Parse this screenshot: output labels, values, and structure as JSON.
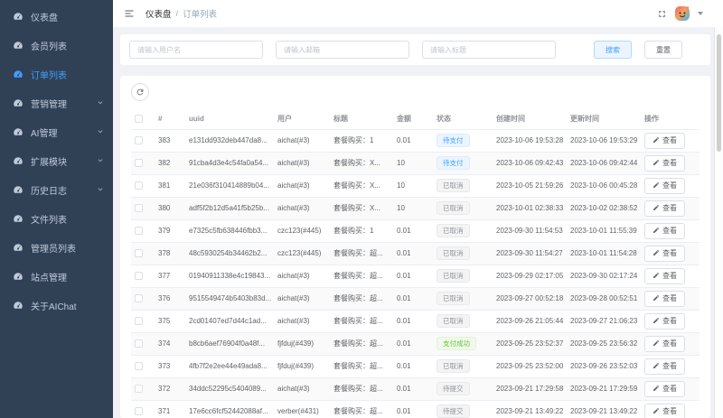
{
  "sidebar": {
    "items": [
      {
        "id": "dashboard",
        "label": "仪表盘",
        "active": false,
        "expandable": false
      },
      {
        "id": "members",
        "label": "会员列表",
        "active": false,
        "expandable": false
      },
      {
        "id": "orders",
        "label": "订单列表",
        "active": true,
        "expandable": false
      },
      {
        "id": "marketing",
        "label": "营销管理",
        "active": false,
        "expandable": true
      },
      {
        "id": "ai",
        "label": "AI管理",
        "active": false,
        "expandable": true
      },
      {
        "id": "modules",
        "label": "扩展模块",
        "active": false,
        "expandable": true
      },
      {
        "id": "logs",
        "label": "历史日志",
        "active": false,
        "expandable": true
      },
      {
        "id": "files",
        "label": "文件列表",
        "active": false,
        "expandable": false
      },
      {
        "id": "admins",
        "label": "管理员列表",
        "active": false,
        "expandable": false
      },
      {
        "id": "site",
        "label": "站点管理",
        "active": false,
        "expandable": false
      },
      {
        "id": "about",
        "label": "关于AIChat",
        "active": false,
        "expandable": false
      }
    ]
  },
  "header": {
    "breadcrumb": {
      "items": [
        "仪表盘",
        "订单列表"
      ],
      "separator": "/"
    },
    "icons": [
      "menu-fold-icon",
      "fullscreen-icon",
      "avatar",
      "caret-down-icon"
    ]
  },
  "filters": {
    "username_placeholder": "请输入用户名",
    "email_placeholder": "请输入邮箱",
    "title_placeholder": "请输入标题",
    "search_label": "搜索",
    "reset_label": "重置"
  },
  "toolbar": {
    "refresh_icon": "refresh-icon"
  },
  "table": {
    "columns": [
      "#",
      "uuid",
      "用户",
      "标题",
      "金额",
      "状态",
      "创建时间",
      "更新时间",
      "操作"
    ],
    "view_label": "查看",
    "rows": [
      {
        "id": "383",
        "uuid": "e131dd932deb447da8...",
        "user": "aichat(#3)",
        "title": "套餐购买：1",
        "amount": "0.01",
        "status": "待支付",
        "status_type": "primary",
        "created": "2023-10-06 19:53:28",
        "updated": "2023-10-06 19:53:29"
      },
      {
        "id": "382",
        "uuid": "91cba4d3e4c54fa0a54...",
        "user": "aichat(#3)",
        "title": "套餐购买：X...",
        "amount": "10",
        "status": "待支付",
        "status_type": "primary",
        "created": "2023-10-06 09:42:43",
        "updated": "2023-10-06 09:42:44"
      },
      {
        "id": "381",
        "uuid": "21e036f310414889b04...",
        "user": "aichat(#3)",
        "title": "套餐购买：X...",
        "amount": "10",
        "status": "已取消",
        "status_type": "info",
        "created": "2023-10-05 21:59:26",
        "updated": "2023-10-06 00:45:28"
      },
      {
        "id": "380",
        "uuid": "adf5f2b12d5a41f5b25b...",
        "user": "aichat(#3)",
        "title": "套餐购买：X...",
        "amount": "10",
        "status": "已取消",
        "status_type": "info",
        "created": "2023-10-01 02:38:33",
        "updated": "2023-10-02 02:38:52"
      },
      {
        "id": "379",
        "uuid": "e7325c5fb638446fbb3...",
        "user": "czc123(#445)",
        "title": "套餐购买：1",
        "amount": "0.01",
        "status": "已取消",
        "status_type": "info",
        "created": "2023-09-30 11:54:53",
        "updated": "2023-10-01 11:55:39"
      },
      {
        "id": "378",
        "uuid": "48c5930254b34462b2...",
        "user": "czc123(#445)",
        "title": "套餐购买：超...",
        "amount": "0.01",
        "status": "已取消",
        "status_type": "info",
        "created": "2023-09-30 11:54:27",
        "updated": "2023-10-01 11:54:28"
      },
      {
        "id": "377",
        "uuid": "01940911338e4c19843...",
        "user": "aichat(#3)",
        "title": "套餐购买：超...",
        "amount": "0.01",
        "status": "已取消",
        "status_type": "info",
        "created": "2023-09-29 02:17:05",
        "updated": "2023-09-30 02:17:24"
      },
      {
        "id": "376",
        "uuid": "9515549474b5403b83d...",
        "user": "aichat(#3)",
        "title": "套餐购买：超...",
        "amount": "0.01",
        "status": "已取消",
        "status_type": "info",
        "created": "2023-09-27 00:52:18",
        "updated": "2023-09-28 00:52:51"
      },
      {
        "id": "375",
        "uuid": "2cd01407ed7d44c1ad...",
        "user": "aichat(#3)",
        "title": "套餐购买：超...",
        "amount": "0.01",
        "status": "已取消",
        "status_type": "info",
        "created": "2023-09-26 21:05:44",
        "updated": "2023-09-27 21:06:23"
      },
      {
        "id": "374",
        "uuid": "b8cb6aef76904f0a48f...",
        "user": "fjfduj(#439)",
        "title": "套餐购买：超...",
        "amount": "0.01",
        "status": "支付成功",
        "status_type": "success",
        "created": "2023-09-25 23:52:37",
        "updated": "2023-09-25 23:56:32"
      },
      {
        "id": "373",
        "uuid": "4fb7f2e2ee44e49ada8...",
        "user": "fjfduj(#439)",
        "title": "套餐购买：超...",
        "amount": "0.01",
        "status": "已取消",
        "status_type": "info",
        "created": "2023-09-25 23:52:00",
        "updated": "2023-09-26 23:52:03"
      },
      {
        "id": "372",
        "uuid": "34ddc52295c5404089...",
        "user": "aichat(#3)",
        "title": "套餐购买：超...",
        "amount": "0.01",
        "status": "待提交",
        "status_type": "info",
        "created": "2023-09-21 17:29:58",
        "updated": "2023-09-21 17:29:59"
      },
      {
        "id": "371",
        "uuid": "17e6cc6fcf52442088af...",
        "user": "verber(#431)",
        "title": "套餐购买：超...",
        "amount": "0.01",
        "status": "待提交",
        "status_type": "info",
        "created": "2023-09-21 13:49:22",
        "updated": "2023-09-21 13:49:22"
      }
    ]
  },
  "colors": {
    "sidebar_bg": "#304156",
    "sidebar_text": "#bfcbd9",
    "accent": "#409eff",
    "status_pending_text": "#409eff",
    "status_pending_bg": "#ecf5ff",
    "status_cancelled_text": "#909399",
    "status_cancelled_bg": "#f4f4f5",
    "status_success_text": "#67c23a",
    "status_success_bg": "#f0f9eb"
  }
}
